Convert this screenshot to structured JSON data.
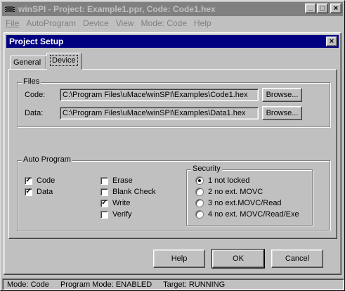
{
  "window": {
    "title": "winSPI - Project: Example1.ppr,  Code: Code1.hex",
    "minimize": "_",
    "maximize": "□",
    "close": "×"
  },
  "menu": [
    {
      "label": "File"
    },
    {
      "label": "AutoProgram"
    },
    {
      "label": "Device"
    },
    {
      "label": "View"
    },
    {
      "label": "Mode: Code"
    },
    {
      "label": "Help"
    }
  ],
  "dialog": {
    "title": "Project Setup",
    "close": "×",
    "tabs": [
      {
        "label": "General",
        "selected": false
      },
      {
        "label": "Device",
        "selected": true
      }
    ],
    "files": {
      "group_label": "Files",
      "code_label": "Code:",
      "code_path": "C:\\Program Files\\uMace\\winSPI\\Examples\\Code1.hex",
      "data_label": "Data:",
      "data_path": "C:\\Program Files\\uMace\\winSPI\\Examples\\Data1.hex",
      "browse_label": "Browse..."
    },
    "auto_program": {
      "group_label": "Auto Program",
      "options": [
        {
          "label": "Code",
          "checked": true
        },
        {
          "label": "Data",
          "checked": true
        },
        {
          "label": "Erase",
          "checked": false
        },
        {
          "label": "Blank Check",
          "checked": false
        },
        {
          "label": "Write",
          "checked": true
        },
        {
          "label": "Verify",
          "checked": false
        }
      ],
      "check_mark": "✓"
    },
    "security": {
      "group_label": "Security",
      "options": [
        {
          "label": "1 not locked",
          "selected": true
        },
        {
          "label": "2 no ext. MOVC",
          "selected": false
        },
        {
          "label": "3 no ext.MOVC/Read",
          "selected": false
        },
        {
          "label": "4 no ext. MOVC/Read/Exe",
          "selected": false
        }
      ]
    },
    "buttons": {
      "help": "Help",
      "ok": "OK",
      "cancel": "Cancel"
    }
  },
  "statusbar": {
    "mode": "Mode: Code",
    "program_mode": "Program Mode: ENABLED",
    "target": "Target: RUNNING"
  },
  "colors": {
    "inactive_titlebar": "#808080",
    "active_titlebar": "#000080",
    "face": "#c0c0c0"
  }
}
